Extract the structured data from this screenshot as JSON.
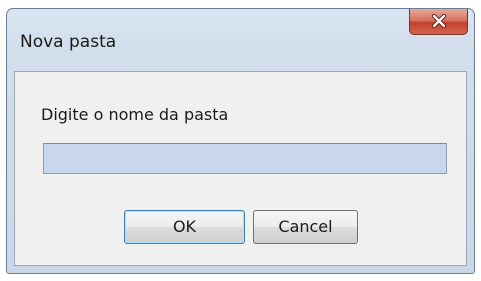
{
  "dialog": {
    "title": "Nova pasta",
    "prompt_label": "Digite o nome da pasta",
    "input_value": "",
    "ok_label": "OK",
    "cancel_label": "Cancel",
    "close_icon": "close-x-icon"
  },
  "colors": {
    "titlebar": "#cad8e9",
    "close_button": "#c2412a",
    "input_background": "#c8d7ed",
    "client_background": "#f0f0f0"
  }
}
